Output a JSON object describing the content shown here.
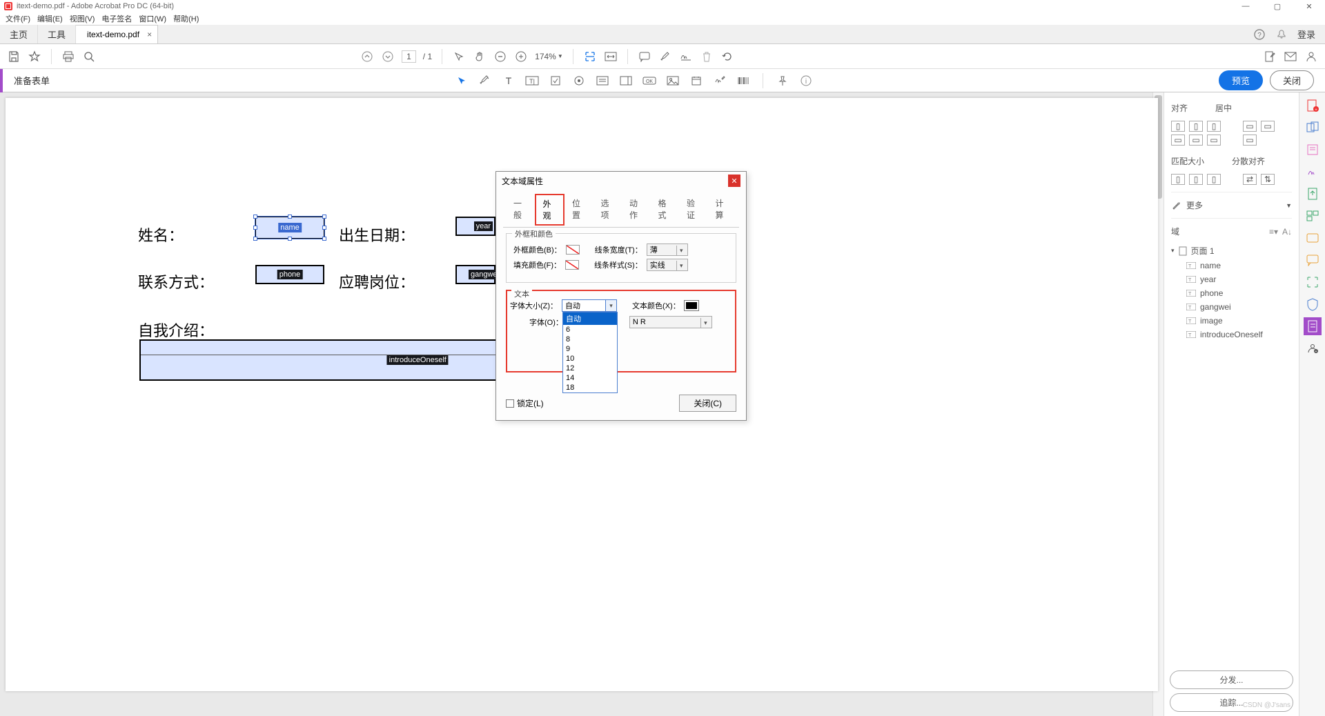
{
  "window": {
    "title": "itext-demo.pdf - Adobe Acrobat Pro DC (64-bit)"
  },
  "menus": [
    "文件(F)",
    "编辑(E)",
    "视图(V)",
    "电子签名",
    "窗口(W)",
    "帮助(H)"
  ],
  "tabs": {
    "main": "主页",
    "tools": "工具",
    "doc": "itext-demo.pdf",
    "login": "登录"
  },
  "toolbar": {
    "page_current": "1",
    "page_sep": "/ 1",
    "zoom": "174%"
  },
  "form_tools": {
    "label": "准备表单",
    "preview": "预览",
    "close": "关闭"
  },
  "document": {
    "labels": {
      "name": "姓名：",
      "birth": "出生日期：",
      "phone": "联系方式：",
      "position": "应聘岗位：",
      "intro": "自我介绍："
    },
    "fields": {
      "f_name": "name",
      "f_year": "year",
      "f_phone": "phone",
      "f_gangwei": "gangwei",
      "f_intro": "introduceOneself"
    }
  },
  "dialog": {
    "title": "文本域属性",
    "tabs": [
      "一般",
      "外观",
      "位置",
      "选项",
      "动作",
      "格式",
      "验证",
      "计算"
    ],
    "active_tab": "外观",
    "group_border": "外框和颜色",
    "group_text": "文本",
    "border_color": "外框颜色(B)：",
    "fill_color": "填充颜色(F)：",
    "line_width": "线条宽度(T)：",
    "line_style": "线条样式(S)：",
    "line_width_val": "薄",
    "line_style_val": "实线",
    "font_size": "字体大小(Z)：",
    "font_size_val": "自动",
    "font_size_options": [
      "自动",
      "6",
      "8",
      "9",
      "10",
      "12",
      "14",
      "18"
    ],
    "text_color": "文本颜色(X)：",
    "font": "字体(O)：",
    "font_val": "N R",
    "lock": "锁定(L)",
    "close_btn": "关闭(C)"
  },
  "right_panel": {
    "align": "对齐",
    "center": "居中",
    "match_size": "匹配大小",
    "distribute": "分散对齐",
    "more": "更多",
    "fields_label": "域",
    "page_label": "页面 1",
    "fields": [
      "name",
      "year",
      "phone",
      "gangwei",
      "image",
      "introduceOneself"
    ],
    "distribute_btn": "分发...",
    "track_btn": "追踪..."
  },
  "watermark": "CSDN @J'sans"
}
